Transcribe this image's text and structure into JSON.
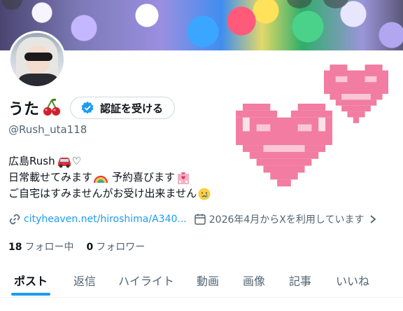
{
  "profile": {
    "display_name": "うた",
    "handle": "@Rush_uta118",
    "verify_button_label": "認証を受ける"
  },
  "bio": {
    "line1": "広島Rush",
    "line1_suffix": "♡",
    "line2a": "日常載せてみます",
    "line2b": "予約喜びます",
    "line3": "ご自宅はすみませんがお受け出来ません"
  },
  "meta": {
    "link_text": "cityheaven.net/hiroshima/A340...",
    "joined_text": "2026年4月からXを利用しています"
  },
  "stats": {
    "following_count": "18",
    "following_label": "フォロー中",
    "followers_count": "0",
    "followers_label": "フォロワー"
  },
  "tabs": [
    {
      "label": "ポスト",
      "active": true
    },
    {
      "label": "返信",
      "active": false
    },
    {
      "label": "ハイライト",
      "active": false
    },
    {
      "label": "動画",
      "active": false
    },
    {
      "label": "画像",
      "active": false
    },
    {
      "label": "記事",
      "active": false
    },
    {
      "label": "いいね",
      "active": false
    }
  ],
  "icons": {
    "verify_badge": "verified-badge-icon",
    "link": "link-icon",
    "calendar": "calendar-icon",
    "chevron": "chevron-right-icon"
  },
  "colors": {
    "accent": "#1d9bf0",
    "text": "#0f1419",
    "muted": "#536471",
    "heart": "#f27ca2"
  }
}
